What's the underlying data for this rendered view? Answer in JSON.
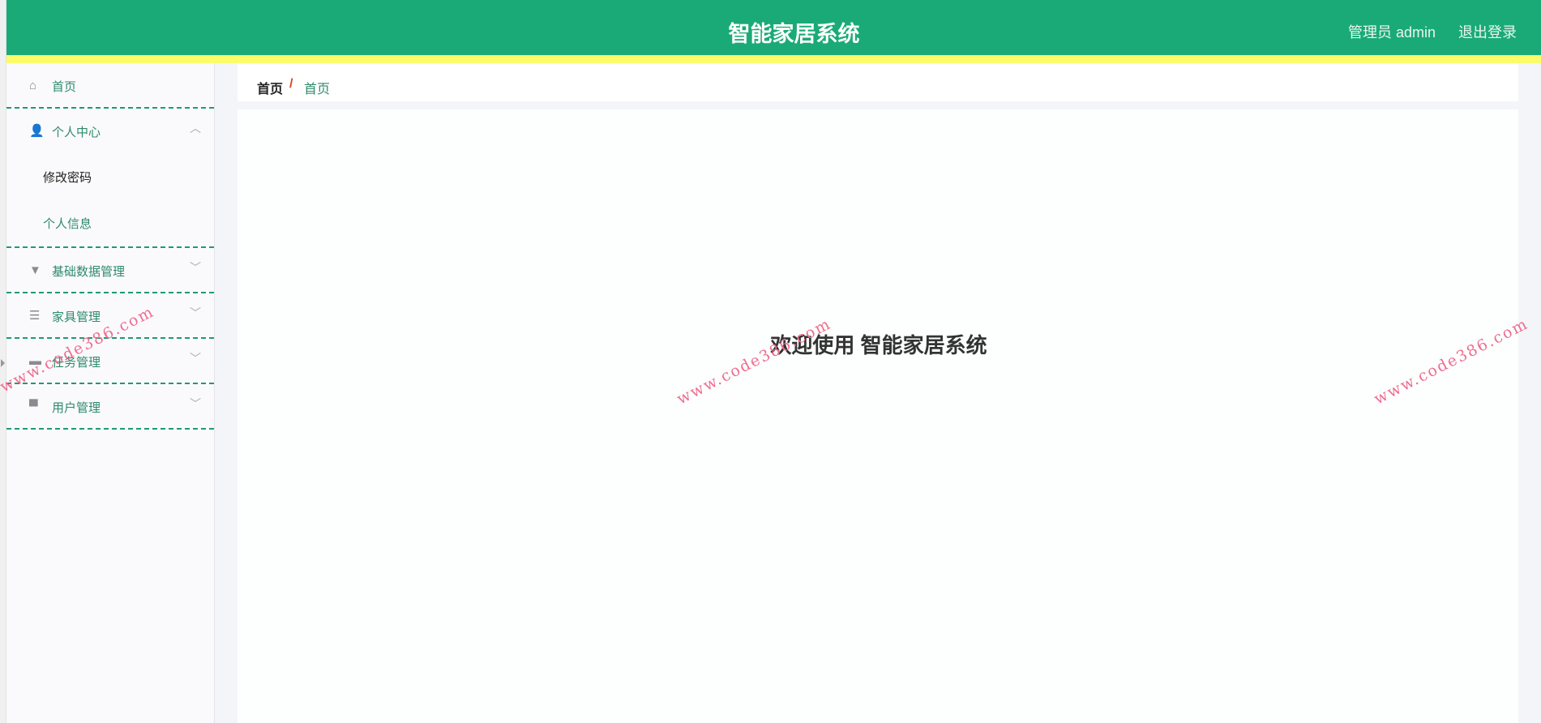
{
  "header": {
    "title": "智能家居系统",
    "user": "管理员 admin",
    "logout": "退出登录"
  },
  "sidebar": {
    "items": [
      {
        "label": "首页",
        "icon": "home-icon"
      },
      {
        "label": "个人中心",
        "icon": "user-icon",
        "expanded": true,
        "children": [
          "修改密码",
          "个人信息"
        ]
      },
      {
        "label": "基础数据管理",
        "icon": "brush-icon"
      },
      {
        "label": "家具管理",
        "icon": "list-icon"
      },
      {
        "label": "任务管理",
        "icon": "briefcase-icon"
      },
      {
        "label": "用户管理",
        "icon": "shop-icon"
      }
    ]
  },
  "breadcrumb": {
    "root": "首页",
    "sep": "/",
    "current": "首页"
  },
  "main": {
    "welcome": "欢迎使用 智能家居系统"
  },
  "watermark": "www.code386.com",
  "colors": {
    "header": "#1aaa78",
    "accent_bar": "#fcfc6a",
    "menu_text": "#2e8a6a"
  }
}
